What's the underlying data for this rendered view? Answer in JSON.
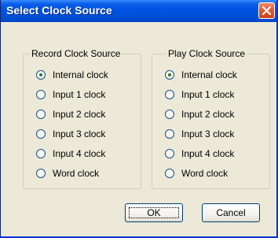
{
  "dialog": {
    "title": "Select Clock Source"
  },
  "record_group": {
    "legend": "Record Clock Source",
    "options": [
      "Internal clock",
      "Input 1 clock",
      "Input 2 clock",
      "Input 3 clock",
      "Input 4 clock",
      "Word clock"
    ],
    "selected": "Internal clock"
  },
  "play_group": {
    "legend": "Play Clock Source",
    "options": [
      "Internal clock",
      "Input 1 clock",
      "Input 2 clock",
      "Input 3 clock",
      "Input 4 clock",
      "Word clock"
    ],
    "selected": "Internal clock"
  },
  "buttons": {
    "ok": "OK",
    "cancel": "Cancel"
  },
  "colors": {
    "titlebar": "#0054e3",
    "dialog_bg": "#ece9d8",
    "close_button": "#e3552a"
  }
}
